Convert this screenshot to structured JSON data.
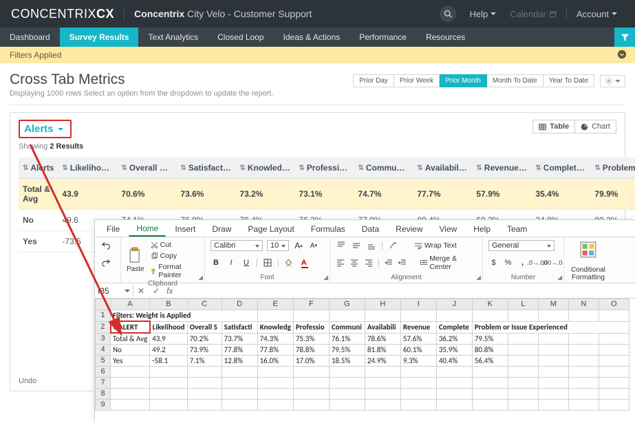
{
  "header": {
    "brand_main": "CONCENTRIX",
    "brand_suffix": "CX",
    "product_prefix": "Concentrix",
    "product_name": "City Velo - Customer Support",
    "help": "Help",
    "calendar": "Calendar",
    "account": "Account"
  },
  "nav": {
    "tabs": [
      "Dashboard",
      "Survey Results",
      "Text Analytics",
      "Closed Loop",
      "Ideas & Actions",
      "Performance",
      "Resources"
    ],
    "active": "Survey Results"
  },
  "filters_bar": {
    "text": "Filters Applied"
  },
  "page": {
    "title": "Cross Tab Metrics",
    "subtitle": "Displaying 1000 rows Select an option from the dropdown to update the report.",
    "time_ranges": [
      "Prior Day",
      "Prior Week",
      "Prior Month",
      "Month To Date",
      "Year To Date"
    ],
    "active_range": "Prior Month"
  },
  "metrics": {
    "dropdown_label": "Alerts",
    "showing_prefix": "Showing",
    "showing_value": "2 Results",
    "view_table": "Table",
    "view_chart": "Chart",
    "columns": [
      "Alerts",
      "Likelihood t…",
      "Overall Sati…",
      "Satisfactio…",
      "Knowledge",
      "Profession…",
      "Communic…",
      "Availability",
      "Revenue at …",
      "Complete T…",
      "Problem or Is…"
    ],
    "rows": [
      {
        "label": "Total & Avg",
        "values": [
          "43.9",
          "70.6%",
          "73.6%",
          "73.2%",
          "73.1%",
          "74.7%",
          "77.7%",
          "57.9%",
          "35.4%",
          "79.9%"
        ],
        "total": true
      },
      {
        "label": "No",
        "values": [
          "49.6",
          "74.1%",
          "76.8%",
          "76.4%",
          "76.3%",
          "77.9%",
          "80.4%",
          "60.3%",
          "34.8%",
          "80.2%"
        ]
      },
      {
        "label": "Yes",
        "values": [
          "-73.5",
          "",
          "",
          "",
          "",
          "",
          "",
          "",
          "",
          ""
        ]
      }
    ]
  },
  "excel": {
    "tabs": [
      "File",
      "Home",
      "Insert",
      "Draw",
      "Page Layout",
      "Formulas",
      "Data",
      "Review",
      "View",
      "Help",
      "Team"
    ],
    "active_tab": "Home",
    "name_box": "I35",
    "fx": "",
    "undo_hint": "Undo",
    "clipboard": {
      "cut": "Cut",
      "copy": "Copy",
      "format_painter": "Format Painter",
      "paste": "Paste",
      "group": "Clipboard"
    },
    "font": {
      "name": "Calibri",
      "size": "10",
      "group": "Font"
    },
    "alignment": {
      "wrap": "Wrap Text",
      "merge": "Merge & Center",
      "group": "Alignment"
    },
    "number": {
      "style": "General",
      "group": "Number"
    },
    "formatting": {
      "label": "Conditional Formatting"
    },
    "cols": [
      "",
      "A",
      "B",
      "C",
      "D",
      "E",
      "F",
      "G",
      "H",
      "I",
      "J",
      "K",
      "L",
      "M",
      "N",
      "O"
    ],
    "rows": [
      {
        "n": 1,
        "bold": true,
        "cells": [
          "Filters: Weight is Applied",
          "",
          "",
          "",
          "",
          "",
          "",
          "",
          "",
          "",
          "",
          "",
          "",
          "",
          ""
        ]
      },
      {
        "n": 2,
        "bold": true,
        "cells": [
          "QALERT",
          "Likelihood",
          "Overall S",
          "Satisfacti",
          "Knowledg",
          "Professio",
          "Communi",
          "Availabili",
          "Revenue",
          "Complete",
          "Problem or Issue Experienced",
          "",
          "",
          "",
          ""
        ]
      },
      {
        "n": 3,
        "cells": [
          "Total & Avg",
          "43.9",
          "70.2%",
          "73.7%",
          "74.3%",
          "75.3%",
          "76.1%",
          "78.6%",
          "57.6%",
          "36.2%",
          "79.5%",
          "",
          "",
          "",
          ""
        ]
      },
      {
        "n": 4,
        "cells": [
          "No",
          "49.2",
          "73.9%",
          "77.8%",
          "77.8%",
          "78.8%",
          "79.5%",
          "81.8%",
          "60.1%",
          "35.9%",
          "80.8%",
          "",
          "",
          "",
          ""
        ]
      },
      {
        "n": 5,
        "cells": [
          "Yes",
          "-58.1",
          "7.1%",
          "12.8%",
          "16.0%",
          "17.0%",
          "18.5%",
          "24.9%",
          "9.3%",
          "40.4%",
          "56.4%",
          "",
          "",
          "",
          ""
        ]
      },
      {
        "n": 6,
        "cells": [
          "",
          "",
          "",
          "",
          "",
          "",
          "",
          "",
          "",
          "",
          "",
          "",
          "",
          "",
          ""
        ]
      },
      {
        "n": 7,
        "cells": [
          "",
          "",
          "",
          "",
          "",
          "",
          "",
          "",
          "",
          "",
          "",
          "",
          "",
          "",
          ""
        ]
      },
      {
        "n": 8,
        "cells": [
          "",
          "",
          "",
          "",
          "",
          "",
          "",
          "",
          "",
          "",
          "",
          "",
          "",
          "",
          ""
        ]
      },
      {
        "n": 9,
        "cells": [
          "",
          "",
          "",
          "",
          "",
          "",
          "",
          "",
          "",
          "",
          "",
          "",
          "",
          "",
          ""
        ]
      }
    ]
  }
}
